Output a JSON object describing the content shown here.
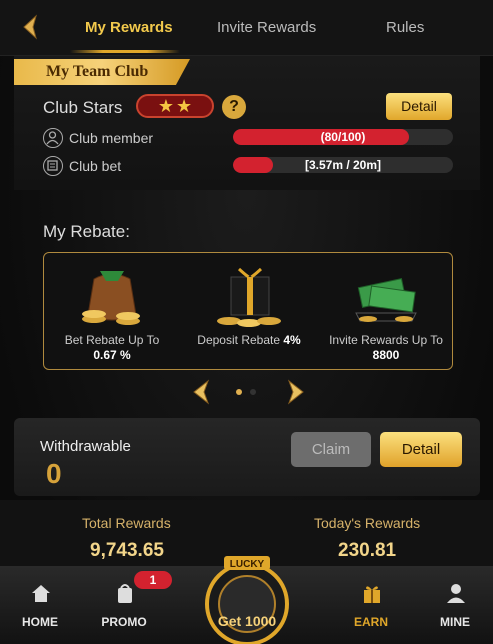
{
  "nav": {
    "tabs": [
      {
        "label": "My Rewards",
        "active": true
      },
      {
        "label": "Invite Rewards",
        "active": false
      },
      {
        "label": "Rules",
        "active": false
      }
    ]
  },
  "team_club": {
    "ribbon": "My Team Club",
    "club_stars_label": "Club Stars",
    "stars": 2,
    "detail_label": "Detail",
    "rows": [
      {
        "label": "Club member",
        "progress_text": "(80/100)",
        "progress": 0.8
      },
      {
        "label": "Club bet",
        "progress_text": "[3.57m / 20m]",
        "progress": 0.18
      }
    ]
  },
  "rebate": {
    "title": "My Rebate:",
    "items": [
      {
        "label": "Bet Rebate Up To",
        "value": "0.67 %",
        "icon": "money-bag-icon"
      },
      {
        "label": "Deposit Rebate",
        "value": "4%",
        "icon": "gift-box-icon"
      },
      {
        "label": "Invite Rewards Up To",
        "value": "8800",
        "icon": "cash-stack-icon"
      }
    ],
    "page": 1,
    "page_count": 2
  },
  "withdraw": {
    "label": "Withdrawable",
    "value": "0",
    "claim_label": "Claim",
    "detail_label": "Detail"
  },
  "totals": {
    "total_label": "Total Rewards",
    "total_value": "9,743.65",
    "today_label": "Today's Rewards",
    "today_value": "230.81"
  },
  "bottom_nav": {
    "items": [
      {
        "label": "HOME",
        "icon": "home-icon"
      },
      {
        "label": "PROMO",
        "icon": "promo-icon",
        "badge": "1"
      },
      {
        "label": "EARN",
        "icon": "gift-icon"
      },
      {
        "label": "MINE",
        "icon": "user-icon"
      }
    ],
    "lucky_label": "LUCKY",
    "get_label": "Get 1000"
  },
  "colors": {
    "accent": "#e0a72a",
    "progress": "#d3222f",
    "badge": "#d3222f"
  }
}
